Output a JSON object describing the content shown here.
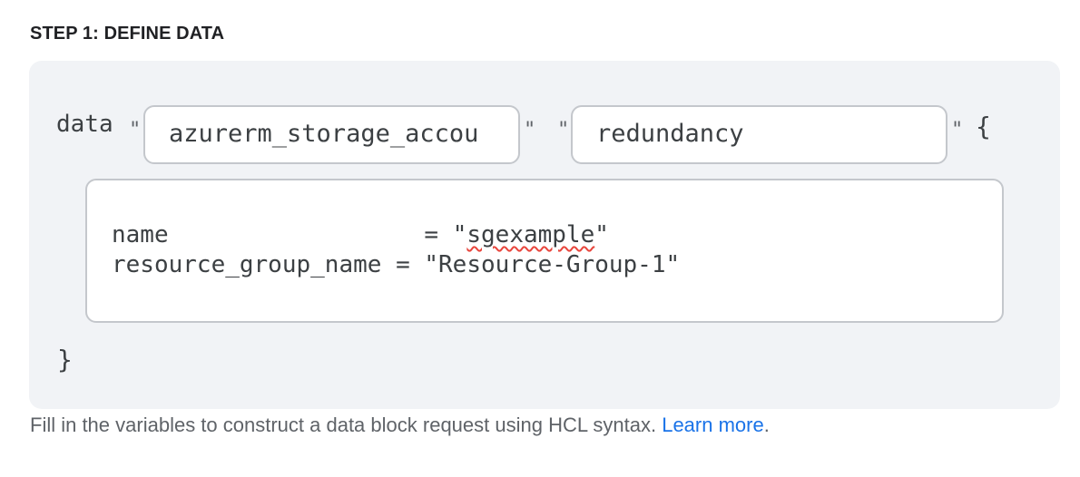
{
  "step_title": "STEP 1: DEFINE DATA",
  "code": {
    "keyword": "data",
    "quote": "\"",
    "open_brace": "{",
    "close_brace": "}",
    "resource_type_value": "azurerm_storage_accou",
    "data_name_value": "redundancy",
    "body": {
      "line1_key": "name",
      "line1_pad": "                  ",
      "line1_eq": "= ",
      "line1_q_open": "\"",
      "line1_value": "sgexample",
      "line1_q_close": "\"",
      "line2_text": "resource_group_name = \"Resource-Group-1\""
    }
  },
  "caption": {
    "text": "Fill in the variables to construct a data block request using HCL syntax. ",
    "link_text": "Learn more",
    "suffix": "."
  },
  "colors": {
    "panel_bg": "#f1f3f6",
    "field_border": "#c4c7cc",
    "link": "#1a73e8",
    "spellcheck": "#e8453c"
  }
}
